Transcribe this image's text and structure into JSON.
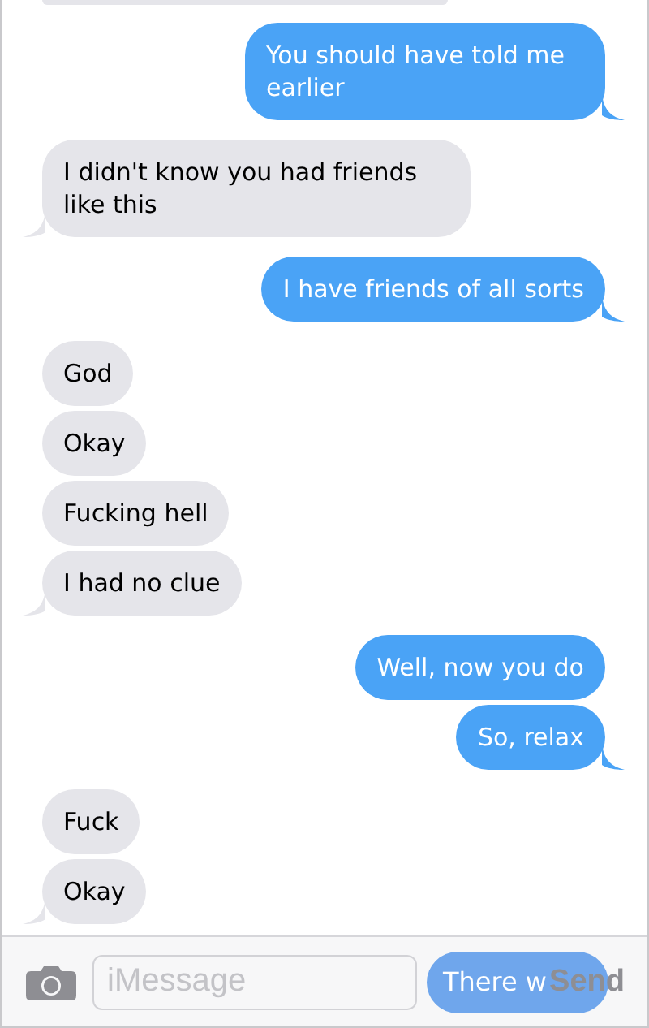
{
  "messages": [
    {
      "kind": "received",
      "cut_off": true
    },
    {
      "kind": "sent",
      "text": "You should have told me earlier",
      "tail": true
    },
    {
      "kind": "received",
      "text": "I didn't know you had friends like this",
      "tail": true
    },
    {
      "kind": "sent",
      "text": "I have friends of all sorts",
      "tail": true
    },
    {
      "kind": "received",
      "text": "God",
      "tail": false
    },
    {
      "kind": "received",
      "text": "Okay",
      "tail": false
    },
    {
      "kind": "received",
      "text": "Fucking hell",
      "tail": false
    },
    {
      "kind": "received",
      "text": "I had no clue",
      "tail": true
    },
    {
      "kind": "sent",
      "text": "Well, now you do",
      "tail": false
    },
    {
      "kind": "sent",
      "text": "So, relax",
      "tail": true
    },
    {
      "kind": "received",
      "text": "Fuck",
      "tail": false
    },
    {
      "kind": "received",
      "text": "Okay",
      "tail": true
    }
  ],
  "composer": {
    "placeholder": "iMessage",
    "send": "Send",
    "underlying_message": "There w"
  }
}
